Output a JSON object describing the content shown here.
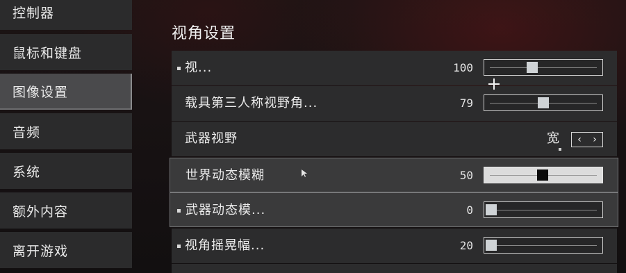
{
  "sidebar": {
    "items": [
      {
        "label": "控制器",
        "active": false
      },
      {
        "label": "鼠标和键盘",
        "active": false
      },
      {
        "label": "图像设置",
        "active": true
      },
      {
        "label": "音频",
        "active": false
      },
      {
        "label": "系统",
        "active": false
      },
      {
        "label": "额外内容",
        "active": false
      },
      {
        "label": "离开游戏",
        "active": false
      }
    ]
  },
  "section": {
    "title": "视角设置"
  },
  "settings": [
    {
      "label": "视...",
      "value": "100",
      "slider_fraction": 0.4
    },
    {
      "label": "载具第三人称视野角...",
      "value": "79",
      "slider_fraction": 0.51
    },
    {
      "label": "武器视野",
      "value": "宽",
      "arrows": [
        "‹",
        "›"
      ]
    },
    {
      "label": "世界动态模糊",
      "value": "50",
      "slider_fraction": 0.5
    },
    {
      "label": "武器动态模...",
      "value": "0",
      "slider_fraction": 0.0
    },
    {
      "label": "视角摇晃幅...",
      "value": "20",
      "slider_fraction": 0.0
    }
  ],
  "colors": {
    "row_bg": "#2c2c2d",
    "row_highlight_bg": "#3a3a3b",
    "sidebar_bg": "#2b2b2c",
    "sidebar_active_bg": "#4a4a4c",
    "accent_red": "#5a1616"
  },
  "icons": {
    "left_arrow": "chevron-left-icon",
    "right_arrow": "chevron-right-icon",
    "crosshair": "plus-cursor-icon",
    "pointer": "mouse-pointer-icon"
  }
}
